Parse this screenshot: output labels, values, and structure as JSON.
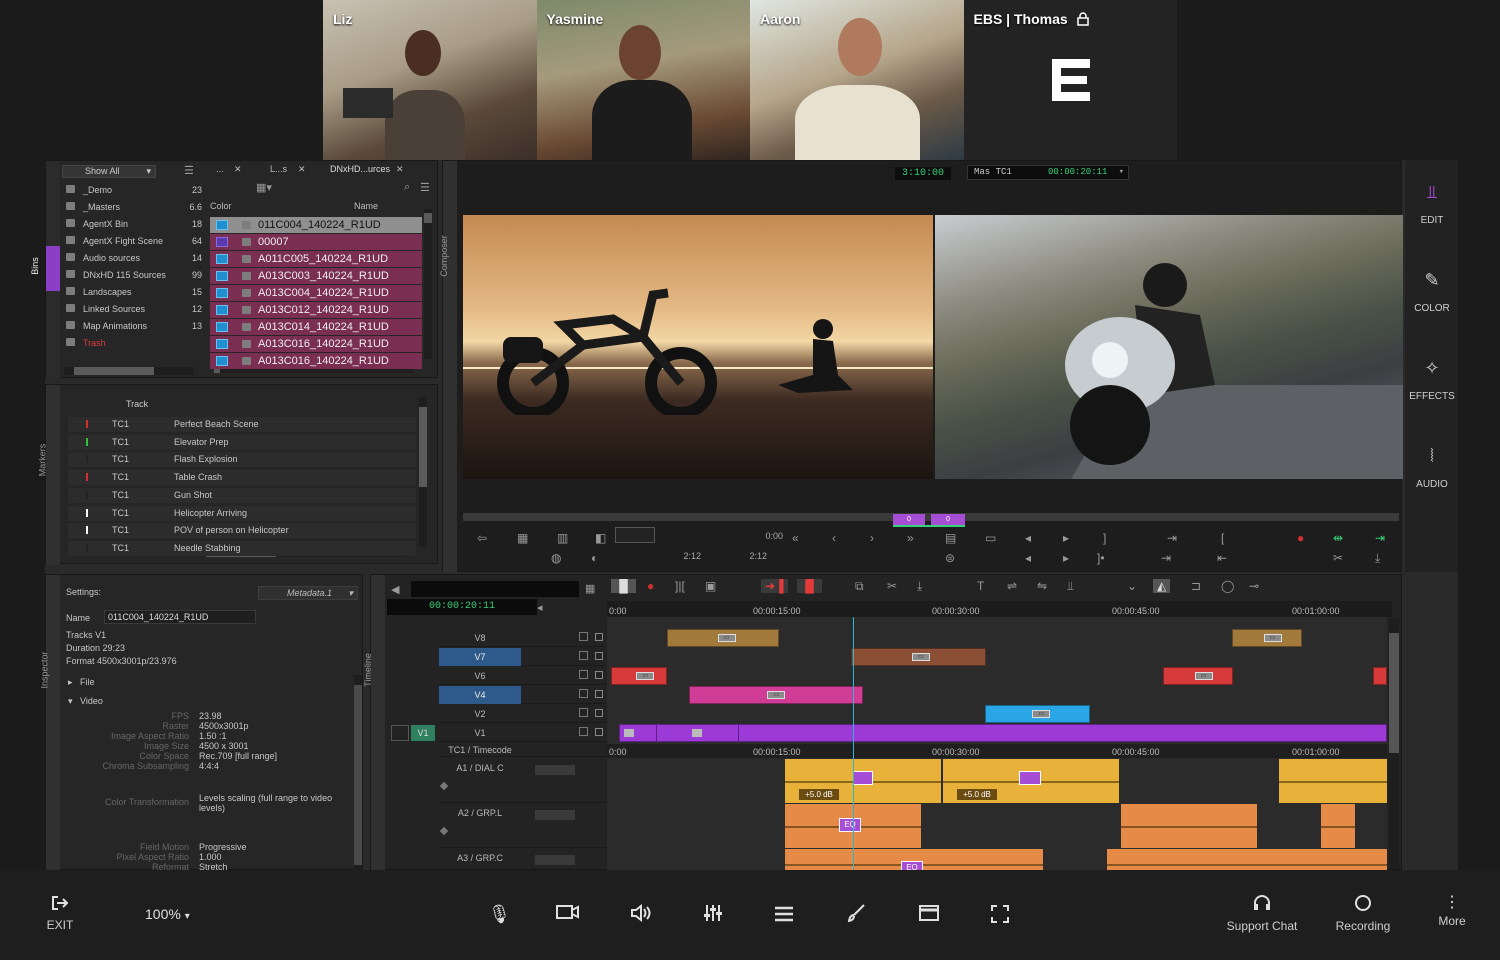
{
  "participants": [
    {
      "name": "Liz"
    },
    {
      "name": "Yasmine"
    },
    {
      "name": "Aaron"
    },
    {
      "name": "EBS | Thomas"
    }
  ],
  "bins": {
    "show_all": "Show All",
    "items": [
      {
        "name": "_Demo",
        "count": "23"
      },
      {
        "name": "_Masters",
        "count": "6.6"
      },
      {
        "name": "AgentX Bin",
        "count": "18"
      },
      {
        "name": "AgentX Fight Scene",
        "count": "64"
      },
      {
        "name": "Audio sources",
        "count": "14"
      },
      {
        "name": "DNxHD 115 Sources",
        "count": "99"
      },
      {
        "name": "Landscapes",
        "count": "15"
      },
      {
        "name": "Linked Sources",
        "count": "12"
      },
      {
        "name": "Map Animations",
        "count": "13"
      },
      {
        "name": "Trash",
        "count": ""
      }
    ],
    "tabs": [
      "...",
      "L...s",
      "DNxHD...urces"
    ],
    "col_color": "Color",
    "col_name": "Name",
    "clips": [
      "011C004_140224_R1UD",
      "00007",
      "A011C005_140224_R1UD",
      "A013C003_140224_R1UD",
      "A013C004_140224_R1UD",
      "A013C012_140224_R1UD",
      "A013C014_140224_R1UD",
      "A013C016_140224_R1UD",
      "A013C016_140224_R1UD"
    ]
  },
  "side_tabs": {
    "bins": "Bins",
    "markers": "Markers",
    "inspector": "Inspector",
    "composer": "Composer",
    "timeline": "Timeline"
  },
  "markers": {
    "header": "Track",
    "rows": [
      {
        "track": "TC1",
        "name": "Perfect Beach Scene",
        "color": "#d03030"
      },
      {
        "track": "TC1",
        "name": "Elevator Prep",
        "color": "#30c040"
      },
      {
        "track": "TC1",
        "name": "Flash Explosion",
        "color": "#222222"
      },
      {
        "track": "TC1",
        "name": "Table Crash",
        "color": "#d03030"
      },
      {
        "track": "TC1",
        "name": "Gun Shot",
        "color": "#222222"
      },
      {
        "track": "TC1",
        "name": "Helicopter Arriving",
        "color": "#ffffff"
      },
      {
        "track": "TC1",
        "name": "POV of person on Helicopter",
        "color": "#ffffff"
      },
      {
        "track": "TC1",
        "name": "Needle Stabbing",
        "color": "#222222"
      }
    ]
  },
  "inspector": {
    "settings_label": "Settings:",
    "preset": "Metadata.1",
    "name_label": "Name",
    "name_value": "011C004_140224_R1UD",
    "tracks": "Tracks    V1",
    "duration": "Duration  29:23",
    "format": "Format    4500x3001p/23.976",
    "file": "File",
    "video": "Video",
    "props": [
      {
        "k": "FPS",
        "v": "23.98"
      },
      {
        "k": "Raster",
        "v": "4500x3001p"
      },
      {
        "k": "Image Aspect Ratio",
        "v": "1.50 :1"
      },
      {
        "k": "Image Size",
        "v": "4500 x 3001"
      },
      {
        "k": "Color Space",
        "v": "Rec.709 [full range]"
      },
      {
        "k": "Chroma Subsampling",
        "v": "4:4:4"
      }
    ],
    "transform_k": "Color Transformation",
    "transform_v": "Levels scaling (full range to video levels)",
    "props2": [
      {
        "k": "Field Motion",
        "v": "Progressive"
      },
      {
        "k": "Pixel Aspect Ratio",
        "v": "1.000"
      },
      {
        "k": "Reformat",
        "v": "Stretch"
      }
    ]
  },
  "composer": {
    "tc_left": "3:10:00",
    "tc_mode": "Mas TC1",
    "tc_right": "00:00:20:11",
    "counter1": "0:00",
    "counter2": "2:12",
    "counter3": "2:12",
    "marker_a": "0",
    "marker_b": "0"
  },
  "timeline": {
    "timecode": "00:00:20:11",
    "ruler": [
      "0:00",
      "00:00:15:00",
      "00:00:30:00",
      "00:00:45:00",
      "00:01:00:00"
    ],
    "tracks": [
      "V8",
      "V7",
      "V6",
      "V4",
      "V2",
      "V1",
      "TC1 / Timecode",
      "A1 / DIAL C",
      "A2 / GRP.L",
      "A3 / GRP.C"
    ],
    "source_track": "V1",
    "gain1": "+5.0 dB",
    "gain2": "+5.0 dB",
    "eq": "EQ"
  },
  "right_panel": [
    {
      "label": "EDIT",
      "icon": "edit-icon"
    },
    {
      "label": "COLOR",
      "icon": "color-icon"
    },
    {
      "label": "EFFECTS",
      "icon": "effects-icon"
    },
    {
      "label": "AUDIO",
      "icon": "audio-icon"
    }
  ],
  "toolbar": {
    "exit": "EXIT",
    "zoom": "100%",
    "support": "Support Chat",
    "recording": "Recording",
    "more": "More"
  },
  "colors": {
    "accent": "#8b3fc6",
    "timecode": "#35d07a",
    "playhead": "#27b8d6"
  }
}
